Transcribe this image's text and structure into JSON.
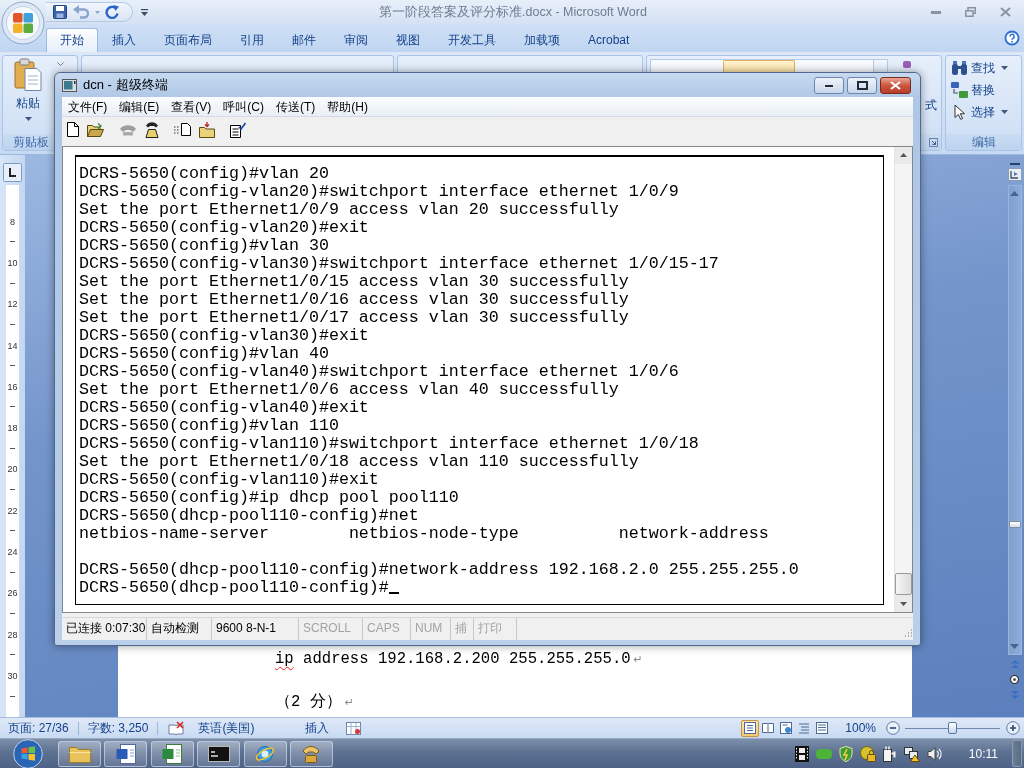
{
  "word": {
    "title": "第一阶段答案及评分标准.docx - Microsoft Word",
    "tabs": [
      {
        "label": "开始",
        "selected": true
      },
      {
        "label": "插入",
        "selected": false
      },
      {
        "label": "页面布局",
        "selected": false
      },
      {
        "label": "引用",
        "selected": false
      },
      {
        "label": "邮件",
        "selected": false
      },
      {
        "label": "审阅",
        "selected": false
      },
      {
        "label": "视图",
        "selected": false
      },
      {
        "label": "开发工具",
        "selected": false
      },
      {
        "label": "加载项",
        "selected": false
      },
      {
        "label": "Acrobat",
        "selected": false
      }
    ],
    "clipboard_group": {
      "paste_label": "粘贴",
      "label": "剪贴板"
    },
    "styles_group": {
      "label_fragment": "式"
    },
    "editing_group": {
      "items": [
        {
          "label": "查找",
          "dropdown": true
        },
        {
          "label": "替换",
          "dropdown": false
        },
        {
          "label": "选择",
          "dropdown": true
        }
      ],
      "label": "编辑"
    },
    "vertical_ruler": [
      "8",
      "10",
      "12",
      "14",
      "16",
      "18",
      "20",
      "22",
      "24",
      "26",
      "28",
      "30"
    ],
    "document": {
      "paragraphs": [
        {
          "segments": [
            {
              "text": "ip",
              "misspelled": true
            },
            {
              "text": " address 192.168.2.200 255.255.255.0",
              "misspelled": false
            }
          ],
          "mark": "↵"
        },
        {
          "segments": [
            {
              "text": "（2 分）",
              "misspelled": false
            }
          ],
          "mark": "↵"
        }
      ]
    },
    "status_bar": {
      "page": "页面: 27/36",
      "words": "字数: 3,250",
      "language": "英语(美国)",
      "mode": "插入",
      "view_buttons": [
        {
          "selected": true
        },
        {
          "selected": false
        },
        {
          "selected": false
        },
        {
          "selected": false
        },
        {
          "selected": false
        }
      ],
      "zoom": "100%",
      "zoom_slider": {
        "level": 0.5
      }
    }
  },
  "terminal": {
    "title": "dcn - 超级终端",
    "menu": [
      "文件(F)",
      "编辑(E)",
      "查看(V)",
      "呼叫(C)",
      "传送(T)",
      "帮助(H)"
    ],
    "toolbar": [
      [
        {
          "disabled": false
        },
        {
          "disabled": false
        }
      ],
      [
        {
          "disabled": true
        },
        {
          "disabled": false
        }
      ],
      [
        {
          "disabled": false
        },
        {
          "disabled": false
        }
      ],
      [
        {
          "disabled": false
        }
      ]
    ],
    "screen": {
      "blocks": [
        [
          "DCRS-5650(config)#vlan 20",
          "DCRS-5650(config-vlan20)#switchport interface ethernet 1/0/9",
          "Set the port Ethernet1/0/9 access vlan 20 successfully",
          "DCRS-5650(config-vlan20)#exit",
          "DCRS-5650(config)#vlan 30",
          "DCRS-5650(config-vlan30)#switchport interface ethernet 1/0/15-17",
          "Set the port Ethernet1/0/15 access vlan 30 successfully",
          "Set the port Ethernet1/0/16 access vlan 30 successfully",
          "Set the port Ethernet1/0/17 access vlan 30 successfully",
          "DCRS-5650(config-vlan30)#exit",
          "DCRS-5650(config)#vlan 40",
          "DCRS-5650(config-vlan40)#switchport interface ethernet 1/0/6",
          "Set the port Ethernet1/0/6 access vlan 40 successfully",
          "DCRS-5650(config-vlan40)#exit",
          "DCRS-5650(config)#vlan 110",
          "DCRS-5650(config-vlan110)#switchport interface ethernet 1/0/18",
          "Set the port Ethernet1/0/18 access vlan 110 successfully",
          "DCRS-5650(config-vlan110)#exit",
          "DCRS-5650(config)#ip dhcp pool pool110",
          "DCRS-5650(dhcp-pool110-config)#net",
          "netbios-name-server        netbios-node-type          network-address"
        ],
        [
          "DCRS-5650(dhcp-pool110-config)#network-address 192.168.2.0 255.255.255.0",
          "DCRS-5650(dhcp-pool110-config)#"
        ]
      ],
      "cursor": true
    },
    "status_bar": [
      {
        "text": "已连接 0:07:30",
        "disabled": false
      },
      {
        "text": "自动检测",
        "disabled": false
      },
      {
        "text": "9600 8-N-1",
        "disabled": false
      },
      {
        "text": "SCROLL",
        "disabled": true
      },
      {
        "text": "CAPS",
        "disabled": true
      },
      {
        "text": "NUM",
        "disabled": true
      },
      {
        "text": "捕",
        "disabled": true
      },
      {
        "text": "打印",
        "disabled": true
      }
    ]
  },
  "taskbar": {
    "clock": "10:11"
  }
}
